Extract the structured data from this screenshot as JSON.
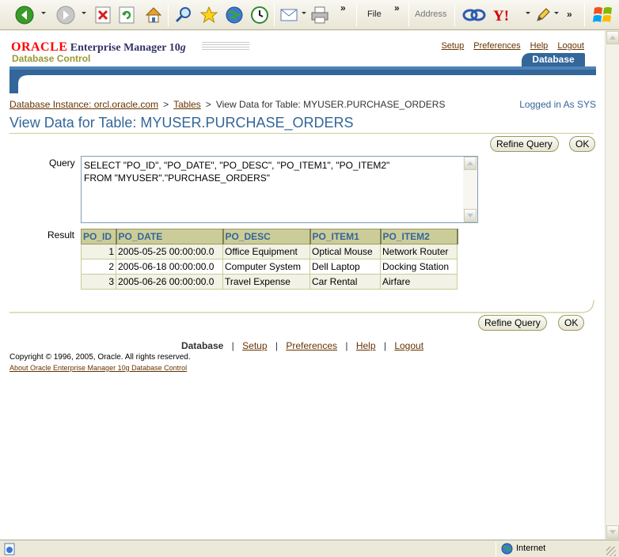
{
  "browser": {
    "toolbar": {
      "file_label": "File",
      "address_label": "Address",
      "overflow_label": "»"
    },
    "status": {
      "zone_label": "Internet"
    }
  },
  "header": {
    "oracle_logo": "ORACLE",
    "product_title_prefix": "Enterprise Manager 10",
    "product_title_version": "g",
    "subtitle": "Database Control",
    "global_links": [
      "Setup",
      "Preferences",
      "Help",
      "Logout"
    ],
    "active_tab": "Database"
  },
  "breadcrumb": {
    "items": [
      "Database Instance: orcl.oracle.com",
      "Tables"
    ],
    "separator": ">",
    "current": "View Data for Table: MYUSER.PURCHASE_ORDERS"
  },
  "logged_in": "Logged in As SYS",
  "page_title": "View Data for Table: MYUSER.PURCHASE_ORDERS",
  "buttons": {
    "refine_query": "Refine Query",
    "ok": "OK"
  },
  "query": {
    "label": "Query",
    "text": "SELECT \"PO_ID\", \"PO_DATE\", \"PO_DESC\", \"PO_ITEM1\", \"PO_ITEM2\"\nFROM \"MYUSER\".\"PURCHASE_ORDERS\""
  },
  "result": {
    "label": "Result",
    "columns": [
      "PO_ID",
      "PO_DATE",
      "PO_DESC",
      "PO_ITEM1",
      "PO_ITEM2"
    ],
    "rows": [
      [
        "1",
        "2005-05-25 00:00:00.0",
        "Office Equipment",
        "Optical Mouse",
        "Network Router"
      ],
      [
        "2",
        "2005-06-18 00:00:00.0",
        "Computer System",
        "Dell Laptop",
        "Docking Station"
      ],
      [
        "3",
        "2005-06-26 00:00:00.0",
        "Travel Expense",
        "Car Rental",
        "Airfare"
      ]
    ]
  },
  "footer": {
    "current": "Database",
    "links": [
      "Setup",
      "Preferences",
      "Help",
      "Logout"
    ],
    "separator": "|",
    "copyright": "Copyright © 1996, 2005, Oracle. All rights reserved.",
    "about_link": "About Oracle Enterprise Manager 10g Database Control"
  },
  "colors": {
    "oracle_red": "#ff0000",
    "title_blue": "#336699",
    "link_brown": "#663300",
    "khaki": "#cccc99"
  }
}
